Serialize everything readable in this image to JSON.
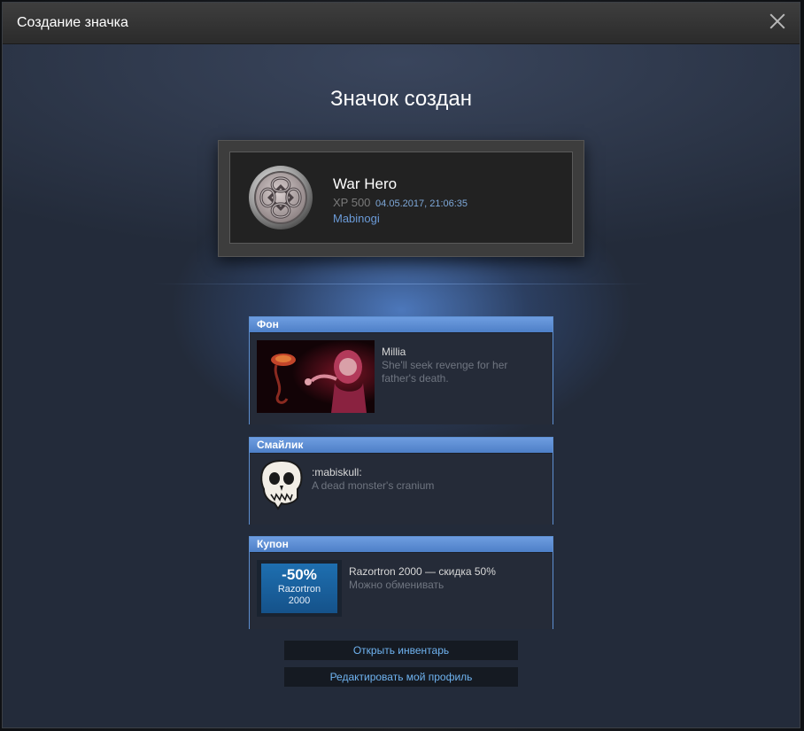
{
  "dialog": {
    "title": "Создание значка",
    "close_icon": "close-icon"
  },
  "main": {
    "heading": "Значок создан"
  },
  "badge": {
    "name": "War Hero",
    "xp": "XP 500",
    "date": "04.05.2017, 21:06:35",
    "game": "Mabinogi",
    "icon": "celtic-knot-medal-icon"
  },
  "rewards": [
    {
      "header": "Фон",
      "name": "Millia",
      "description": "She'll seek revenge for her father's death."
    },
    {
      "header": "Смайлик",
      "name": ":mabiskull:",
      "description": "A dead monster's cranium"
    },
    {
      "header": "Купон",
      "name": "Razortron 2000 — скидка 50%",
      "description": "Можно обменивать",
      "coupon_discount": "-50%",
      "coupon_product": "Razortron",
      "coupon_model": "2000"
    }
  ],
  "buttons": {
    "open_inventory": "Открыть инвентарь",
    "edit_profile": "Редактировать мой профиль"
  },
  "colors": {
    "accent": "#5d8fd1",
    "link": "#6fb3f0",
    "game_link": "#6b9bd8"
  }
}
